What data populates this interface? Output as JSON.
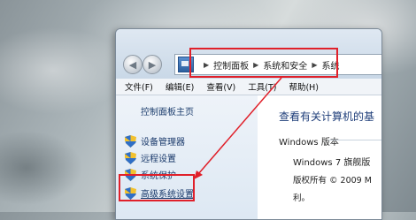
{
  "address_bar": {
    "crumbs": [
      "控制面板",
      "系统和安全",
      "系统"
    ]
  },
  "menu": {
    "file": "文件(F)",
    "edit": "编辑(E)",
    "view": "查看(V)",
    "tools": "工具(T)",
    "help": "帮助(H)"
  },
  "left_pane": {
    "home": "控制面板主页",
    "tasks": [
      "设备管理器",
      "远程设置",
      "系统保护",
      "高级系统设置"
    ]
  },
  "main": {
    "title": "查看有关计算机的基",
    "section_title": "Windows 版本",
    "edition": "Windows 7 旗舰版",
    "copyright": "版权所有 © 2009 M",
    "copyright_cont": "利。"
  },
  "colors": {
    "annotation_red": "#e0202a",
    "link_blue": "#1a3a6b"
  }
}
